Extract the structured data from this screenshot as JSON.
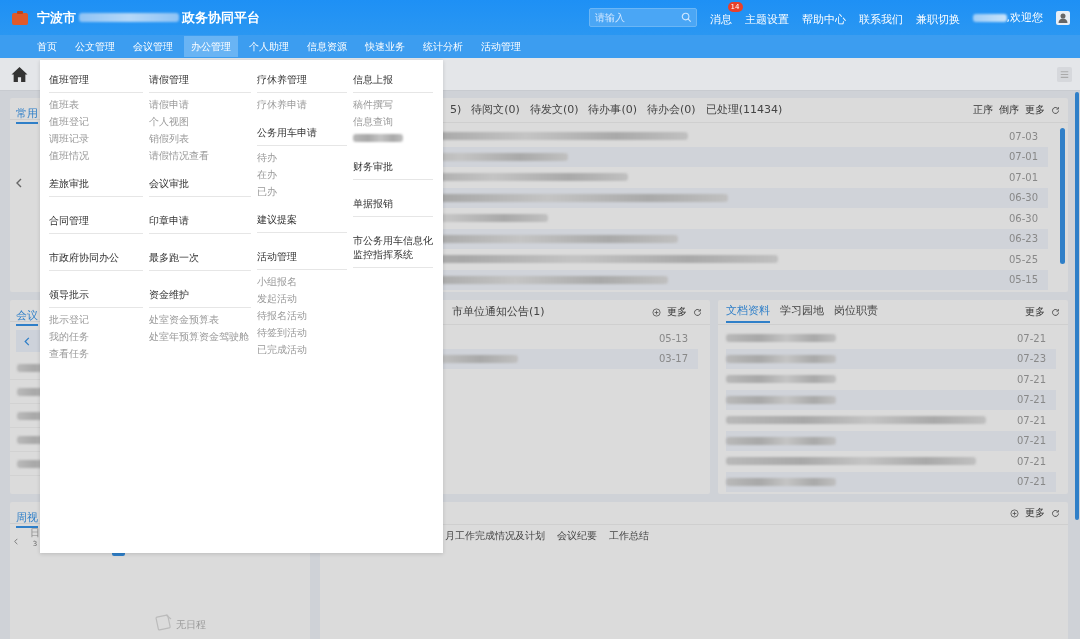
{
  "header": {
    "title_prefix": "宁波市",
    "title_suffix": "政务协同平台",
    "search": {
      "placeholder": "请输入"
    },
    "links": [
      {
        "label": "消息",
        "badge": "14"
      },
      {
        "label": "主题设置"
      },
      {
        "label": "帮助中心"
      },
      {
        "label": "联系我们"
      },
      {
        "label": "兼职切换"
      }
    ],
    "greeting": ",欢迎您"
  },
  "nav": [
    {
      "label": "首页",
      "selected": false
    },
    {
      "label": "公文管理",
      "selected": false
    },
    {
      "label": "会议管理",
      "selected": false
    },
    {
      "label": "办公管理",
      "selected": true
    },
    {
      "label": "个人助理",
      "selected": false
    },
    {
      "label": "信息资源",
      "selected": false
    },
    {
      "label": "快速业务",
      "selected": false
    },
    {
      "label": "统计分析",
      "selected": false
    },
    {
      "label": "活动管理",
      "selected": false
    }
  ],
  "menu": {
    "columns": [
      {
        "groups": [
          {
            "title": "值班管理",
            "items": [
              {
                "label": "值班表"
              },
              {
                "label": "值班登记"
              },
              {
                "label": "调班记录"
              },
              {
                "label": "值班情况"
              }
            ]
          },
          {
            "title": "差旅审批"
          },
          {
            "title": "合同管理"
          },
          {
            "title": "市政府协同办公"
          },
          {
            "title": "领导批示",
            "items": [
              {
                "label": "批示登记"
              },
              {
                "label": "我的任务"
              },
              {
                "label": "查看任务"
              }
            ]
          }
        ]
      },
      {
        "groups": [
          {
            "title": "请假管理",
            "items": [
              {
                "label": "请假申请"
              },
              {
                "label": "个人视图"
              },
              {
                "label": "销假列表"
              },
              {
                "label": "请假情况查看"
              }
            ]
          },
          {
            "title": "会议审批"
          },
          {
            "title": "印章申请"
          },
          {
            "title": "最多跑一次"
          },
          {
            "title": "资金维护",
            "items": [
              {
                "label": "处室资金预算表"
              },
              {
                "label": "处室年预算资金驾驶舱"
              }
            ]
          }
        ]
      },
      {
        "groups": [
          {
            "title": "疗休养管理",
            "items": [
              {
                "label": "疗休养申请"
              }
            ]
          },
          {
            "title": "公务用车申请",
            "items": [
              {
                "label": "待办"
              },
              {
                "label": "在办"
              },
              {
                "label": "已办"
              }
            ]
          },
          {
            "title": "建议提案"
          },
          {
            "title": "活动管理",
            "items": [
              {
                "label": "小组报名"
              },
              {
                "label": "发起活动"
              },
              {
                "label": "待报名活动"
              },
              {
                "label": "待签到活动"
              },
              {
                "label": "已完成活动"
              }
            ]
          }
        ]
      },
      {
        "groups": [
          {
            "title": "信息上报",
            "items": [
              {
                "label": "稿件撰写"
              },
              {
                "label": "信息查询"
              },
              {
                "kind": "redacted"
              }
            ]
          },
          {
            "title": "财务审批"
          },
          {
            "title": "单据报销"
          },
          {
            "title": "市公务用车信息化监控指挥系统"
          }
        ]
      }
    ]
  },
  "left": {
    "common": {
      "tab": "常用"
    },
    "meeting": {
      "tab": "会议",
      "rows": [
        {
          "redacted": true
        },
        {
          "redacted": true
        },
        {
          "redacted": true
        },
        {
          "redacted": true
        },
        {
          "redacted": true
        }
      ]
    },
    "week": {
      "tab": "周视",
      "weekday": "日",
      "day": "3",
      "empty_text": "无日程"
    }
  },
  "inbox": {
    "tabs": [
      {
        "label": "5)",
        "selected": false
      },
      {
        "label": "待阅文(0)",
        "selected": false
      },
      {
        "label": "待发文(0)",
        "selected": false
      },
      {
        "label": "待办事(0)",
        "selected": false
      },
      {
        "label": "待办会(0)",
        "selected": false
      },
      {
        "label": "已处理(11434)",
        "selected": false
      }
    ],
    "actions": [
      "正序",
      "倒序",
      "更多"
    ],
    "rows": [
      {
        "date": "07-03",
        "redacted": true
      },
      {
        "date": "07-01",
        "redacted": true
      },
      {
        "date": "07-01",
        "redacted": true
      },
      {
        "date": "06-30",
        "redacted": true
      },
      {
        "date": "06-30",
        "redacted": true
      },
      {
        "date": "06-23",
        "redacted": true
      },
      {
        "date": "05-25",
        "redacted": true
      },
      {
        "date": "05-15",
        "redacted": true
      }
    ]
  },
  "notices": {
    "tabs": [
      {
        "label": "市单位通知公告(1)",
        "selected": false
      }
    ],
    "more": "更多",
    "rows": [
      {
        "date": "05-13",
        "redacted": false
      },
      {
        "date": "03-17",
        "redacted": true
      }
    ]
  },
  "docs": {
    "tabs": [
      {
        "label": "文档资料",
        "selected": true
      },
      {
        "label": "学习园地",
        "selected": false
      },
      {
        "label": "岗位职责",
        "selected": false
      }
    ],
    "more": "更多",
    "rows": [
      {
        "date": "07-21",
        "redacted": true
      },
      {
        "date": "07-23",
        "redacted": true
      },
      {
        "date": "07-21",
        "redacted": true
      },
      {
        "date": "07-21",
        "redacted": true
      },
      {
        "date": "07-21",
        "redacted": true
      },
      {
        "date": "07-21",
        "redacted": true
      },
      {
        "date": "07-21",
        "redacted": true
      },
      {
        "date": "07-21",
        "redacted": true
      }
    ]
  },
  "reports": {
    "more": "更多",
    "tabs": [
      {
        "label": "月工作完成情况及计划",
        "selected": false
      },
      {
        "label": "会议纪要",
        "selected": false
      },
      {
        "label": "工作总结",
        "selected": false
      }
    ]
  }
}
